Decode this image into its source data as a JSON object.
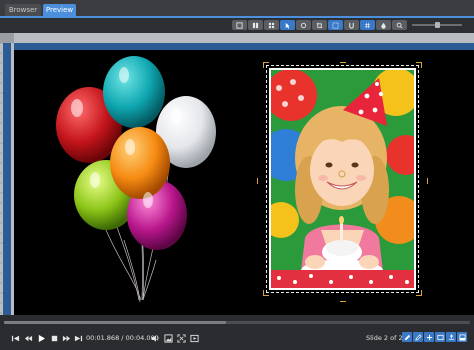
{
  "tabs": [
    {
      "label": "Browser"
    },
    {
      "label": "Preview"
    }
  ],
  "toolbar": {
    "buttons": [
      {
        "icon": "single-view-icon"
      },
      {
        "icon": "grid-2-icon"
      },
      {
        "icon": "grid-4-icon"
      },
      {
        "icon": "object-mode-icon"
      },
      {
        "icon": "transition-icon"
      },
      {
        "icon": "safe-area-icon"
      },
      {
        "icon": "snap-icon"
      },
      {
        "icon": "grid-lines-icon"
      },
      {
        "icon": "drop-icon"
      },
      {
        "icon": "zoom-out-icon"
      }
    ],
    "active_buttons": [
      "object-mode-icon",
      "safe-area-icon",
      "grid-lines-icon"
    ],
    "zoom_level": 0.5
  },
  "player": {
    "progress": 0.476,
    "current_time": "00:01.868",
    "separator": "/",
    "total_time": "00:04.000",
    "slide_info": "Slide 2 of 2",
    "controls": [
      {
        "icon": "skip-to-start-icon"
      },
      {
        "icon": "step-back-icon"
      },
      {
        "icon": "play-icon"
      },
      {
        "icon": "stop-icon"
      },
      {
        "icon": "step-forward-icon"
      },
      {
        "icon": "skip-to-end-icon"
      }
    ],
    "right_tools": [
      {
        "icon": "volume-icon"
      },
      {
        "icon": "snapshot-icon"
      },
      {
        "icon": "fullscreen-icon"
      },
      {
        "icon": "preview-window-icon"
      }
    ],
    "slide_tools": [
      {
        "icon": "edit-icon"
      },
      {
        "icon": "edit-alt-icon"
      },
      {
        "icon": "add-icon"
      },
      {
        "icon": "slide-icon"
      },
      {
        "icon": "export-icon"
      },
      {
        "icon": "dock-icon"
      }
    ]
  },
  "colors": {
    "accent": "#4c8fdc",
    "background": "#2d2f33",
    "canvas": "#000000",
    "ruler": "#b9bcc0",
    "ruler_band": "#2b5c96",
    "handle": "#d6a23c"
  }
}
